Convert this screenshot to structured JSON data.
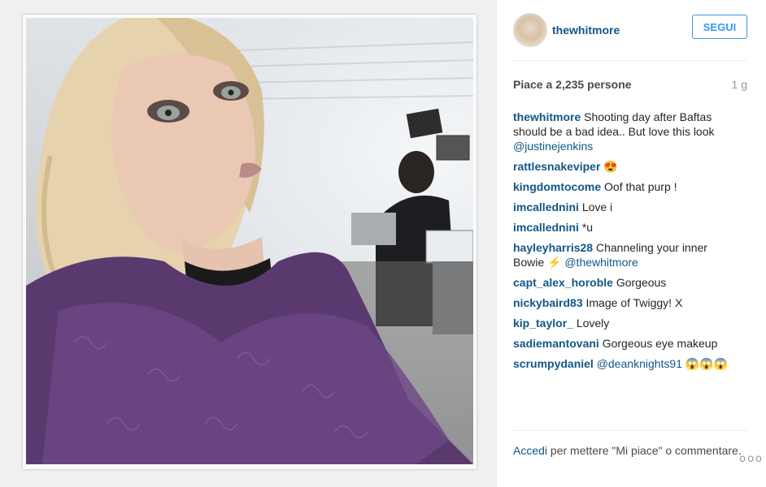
{
  "post": {
    "username": "thewhitmore",
    "follow_label": "SEGUI",
    "likes_text": "Piace a 2,235 persone",
    "time_ago": "1 g"
  },
  "comments": [
    {
      "user": "thewhitmore",
      "text": "Shooting day after Baftas should be a bad idea.. But love this look",
      "mention": "@justinejenkins"
    },
    {
      "user": "rattlesnakeviper",
      "text": "😍",
      "mention": ""
    },
    {
      "user": "kingdomtocome",
      "text": "Oof that purp !",
      "mention": ""
    },
    {
      "user": "imcallednini",
      "text": "Love i",
      "mention": ""
    },
    {
      "user": "imcallednini",
      "text": "*u",
      "mention": ""
    },
    {
      "user": "hayleyharris28",
      "text": "Channeling your inner Bowie ⚡",
      "mention": "@thewhitmore"
    },
    {
      "user": "capt_alex_horoble",
      "text": "Gorgeous",
      "mention": ""
    },
    {
      "user": "nickybaird83",
      "text": "Image of Twiggy! X",
      "mention": ""
    },
    {
      "user": "kip_taylor_",
      "text": "Lovely",
      "mention": ""
    },
    {
      "user": "sadiemantovani",
      "text": "Gorgeous eye makeup",
      "mention": ""
    },
    {
      "user": "scrumpydaniel",
      "text": "😱😱😱",
      "mention": "@deanknights91"
    }
  ],
  "footer": {
    "login_link": "Accedi",
    "login_text": "per mettere \"Mi piace\" o commentare.",
    "more_label": "ooo"
  },
  "colors": {
    "accent": "#3897f0",
    "username": "#125688"
  }
}
